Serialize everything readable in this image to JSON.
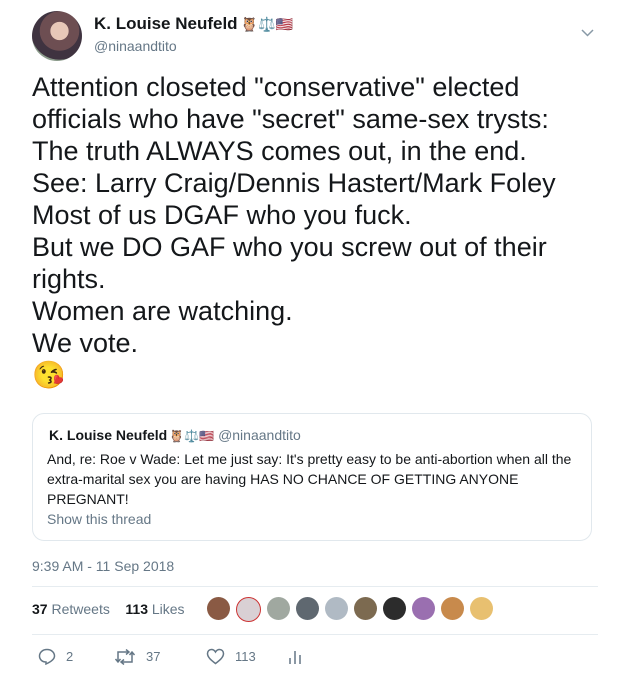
{
  "author": {
    "name": "K. Louise Neufeld",
    "badges": "🦉⚖️🇺🇸",
    "handle": "@ninaandtito"
  },
  "tweet": {
    "text": "Attention closeted \"conservative\" elected\nofficials who have \"secret\" same-sex trysts:\nThe truth ALWAYS comes out, in the end.\nSee: Larry Craig/Dennis Hastert/Mark Foley\nMost of us DGAF who you fuck.\nBut we DO GAF who you screw out of their\nrights.\nWomen are watching.\nWe vote.\n😘"
  },
  "quoted_tweet": {
    "name": "K. Louise Neufeld",
    "badges": "🦉⚖️🇺🇸",
    "handle": "@ninaandtito",
    "text": "And, re: Roe v Wade: Let me just say: It's pretty easy to be anti-abortion when all the extra-marital sex you are having HAS NO CHANCE OF GETTING ANYONE PREGNANT!",
    "show_thread": "Show this thread"
  },
  "timestamp": "9:39 AM - 11 Sep 2018",
  "stats": {
    "retweets_count": "37",
    "retweets_label": "Retweets",
    "likes_count": "113",
    "likes_label": "Likes"
  },
  "actions": {
    "replies": "2",
    "retweets": "37",
    "likes": "113"
  },
  "colors": {
    "secondary_text": "#657786",
    "border": "#e1e8ed"
  }
}
